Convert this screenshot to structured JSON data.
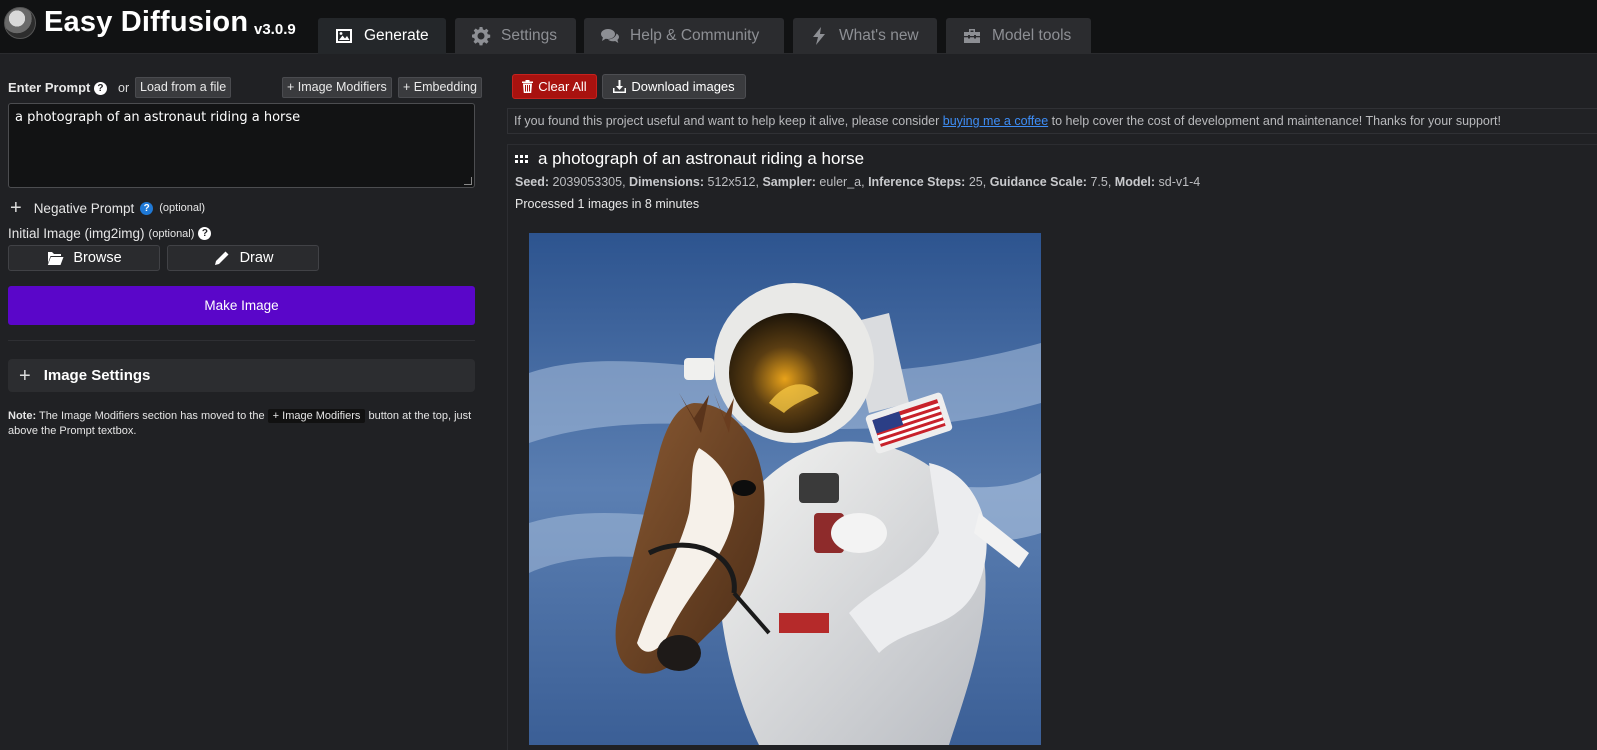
{
  "app": {
    "title": "Easy Diffusion",
    "version": "v3.0.9"
  },
  "tabs": [
    {
      "label": "Generate",
      "icon": "image-icon",
      "active": true
    },
    {
      "label": "Settings",
      "icon": "gear-icon",
      "active": false
    },
    {
      "label": "Help & Community",
      "icon": "comments-icon",
      "active": false
    },
    {
      "label": "What's new",
      "icon": "bolt-icon",
      "active": false
    },
    {
      "label": "Model tools",
      "icon": "toolbox-icon",
      "active": false
    }
  ],
  "prompt": {
    "label": "Enter Prompt",
    "or_text": "or",
    "load_label": "Load from a file",
    "modifiers_label": "+ Image Modifiers",
    "embedding_label": "+ Embedding",
    "value": "a photograph of an astronaut riding a horse"
  },
  "negative": {
    "label": "Negative Prompt",
    "optional": "(optional)"
  },
  "initial_image": {
    "label": "Initial Image (img2img)",
    "optional": "(optional)",
    "browse_label": "Browse",
    "draw_label": "Draw"
  },
  "make_image_label": "Make Image",
  "image_settings_label": "Image Settings",
  "note": {
    "prefix": "Note:",
    "text1": "The Image Modifiers section has moved to the",
    "code": "+ Image Modifiers",
    "text2": "button at the top, just above the Prompt textbox."
  },
  "toolbar": {
    "clear_label": "Clear All",
    "download_label": "Download images"
  },
  "support": {
    "text1": "If you found this project useful and want to help keep it alive, please consider",
    "link": "buying me a coffee",
    "text2": "to help cover the cost of development and maintenance! Thanks for your support!"
  },
  "result": {
    "title": "a photograph of an astronaut riding a horse",
    "seed_label": "Seed:",
    "seed": "2039053305",
    "dims_label": "Dimensions:",
    "dims": "512x512",
    "sampler_label": "Sampler:",
    "sampler": "euler_a",
    "steps_label": "Inference Steps:",
    "steps": "25",
    "guidance_label": "Guidance Scale:",
    "guidance": "7.5",
    "model_label": "Model:",
    "model": "sd-v1-4",
    "processed": "Processed 1 images in 8 minutes"
  },
  "colors": {
    "accent": "#5a06c9",
    "danger": "#a8120f",
    "link": "#3e8ef7"
  }
}
